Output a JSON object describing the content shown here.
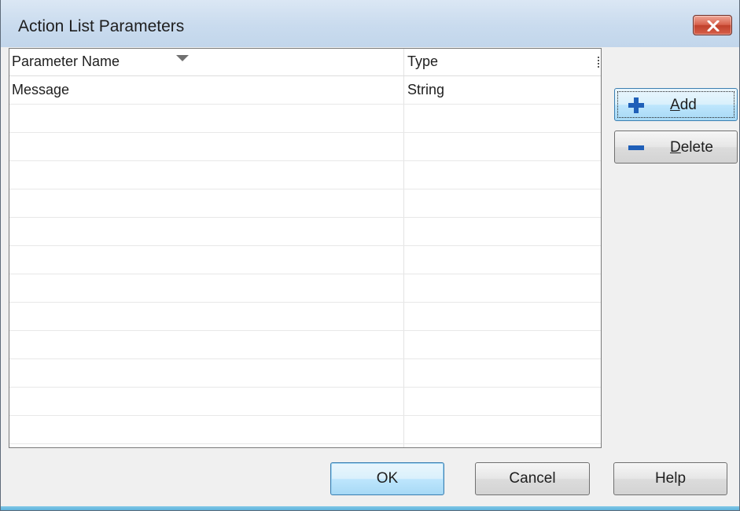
{
  "window": {
    "title": "Action List Parameters",
    "close_icon": "close-icon"
  },
  "grid": {
    "columns": [
      "Parameter Name",
      "Type"
    ],
    "sort_icon": "sort-descending-icon",
    "rows": [
      {
        "name": "Message",
        "type": "String"
      },
      {
        "name": "",
        "type": ""
      },
      {
        "name": "",
        "type": ""
      },
      {
        "name": "",
        "type": ""
      },
      {
        "name": "",
        "type": ""
      },
      {
        "name": "",
        "type": ""
      },
      {
        "name": "",
        "type": ""
      },
      {
        "name": "",
        "type": ""
      },
      {
        "name": "",
        "type": ""
      },
      {
        "name": "",
        "type": ""
      },
      {
        "name": "",
        "type": ""
      },
      {
        "name": "",
        "type": ""
      },
      {
        "name": "",
        "type": ""
      },
      {
        "name": "",
        "type": ""
      }
    ]
  },
  "actions": {
    "add_label": "Add",
    "add_icon": "plus-icon",
    "delete_label": "Delete",
    "delete_icon": "minus-icon"
  },
  "footer": {
    "ok_label": "OK",
    "cancel_label": "Cancel",
    "help_label": "Help"
  },
  "colors": {
    "title_bar": "#c9dbee",
    "icon_blue": "#1f5fb8",
    "close_red": "#c0412c",
    "focus_blue": "#3c7fb1"
  }
}
